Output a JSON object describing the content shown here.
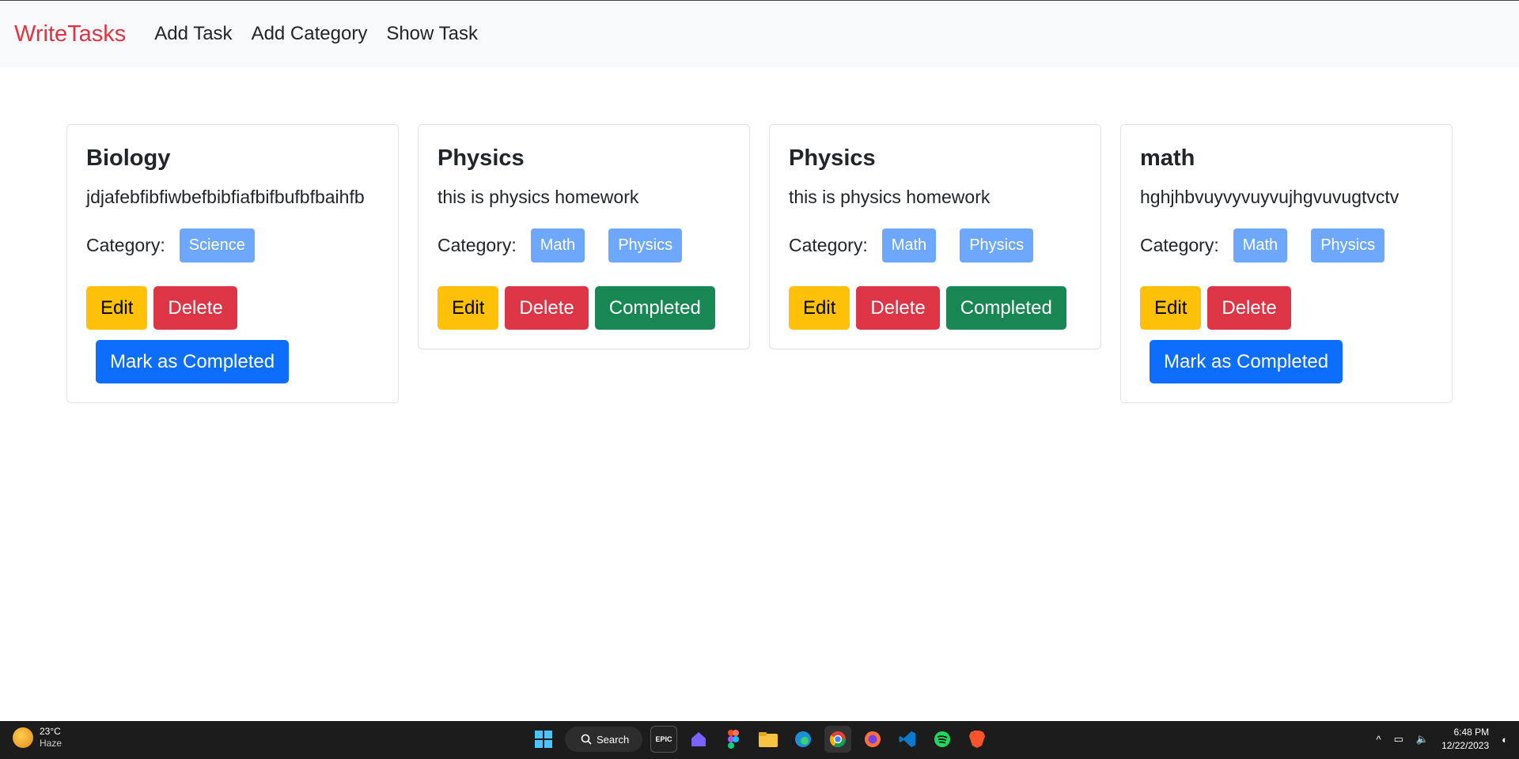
{
  "navbar": {
    "brand": "WriteTasks",
    "links": [
      "Add Task",
      "Add Category",
      "Show Task"
    ]
  },
  "labels": {
    "category": "Category:",
    "edit": "Edit",
    "delete": "Delete",
    "completed": "Completed",
    "mark_completed": "Mark as Completed"
  },
  "tasks": [
    {
      "title": "Biology",
      "description": "jdjafebfibfiwbefbibfiafbifbufbfbaihfb",
      "categories": [
        "Science"
      ]
    },
    {
      "title": "Physics",
      "description": "this is physics homework",
      "categories": [
        "Math",
        "Physics"
      ]
    },
    {
      "title": "Physics",
      "description": "this is physics homework",
      "categories": [
        "Math",
        "Physics"
      ]
    },
    {
      "title": "math",
      "description": "hghjhbvuyvyvuyvujhgvuvugtvctv",
      "categories": [
        "Math",
        "Physics"
      ]
    }
  ],
  "taskbar": {
    "temperature": "23°C",
    "weather": "Haze",
    "search_label": "Search",
    "time": "6:48 PM",
    "date": "12/22/2023"
  },
  "colors": {
    "brand": "#dc3545",
    "edit": "#ffc107",
    "delete": "#dc3545",
    "completed": "#198754",
    "mark": "#0d6efd",
    "badge": "#6ea8fe"
  }
}
